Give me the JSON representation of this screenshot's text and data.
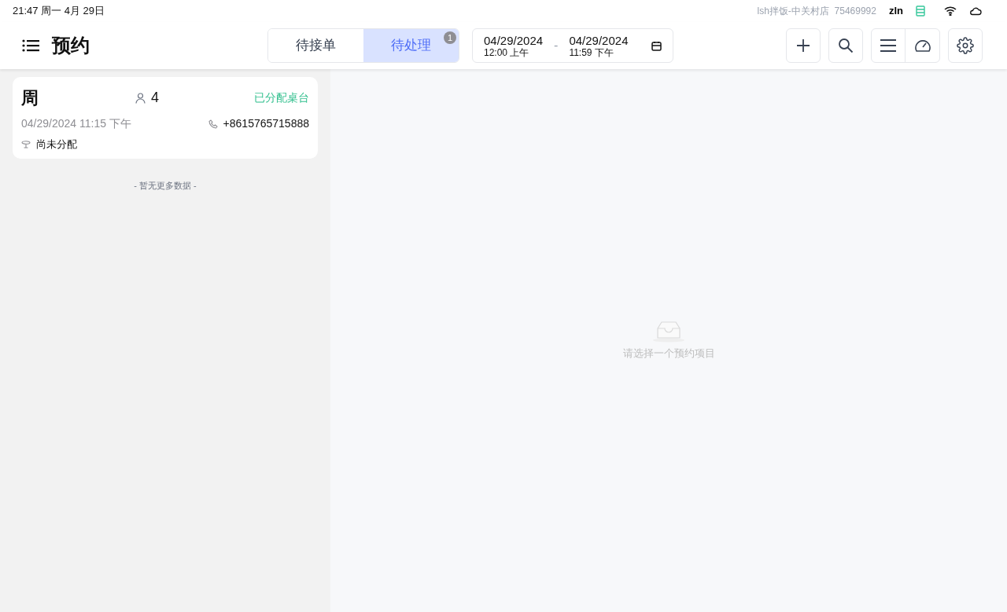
{
  "status_bar": {
    "time": "21:47 周一 4月 29日",
    "store": "lsh拌饭-中关村店  75469992",
    "user": "zln"
  },
  "header": {
    "title": "预约",
    "tabs": [
      {
        "label": "待接单",
        "selected": false
      },
      {
        "label": "待处理",
        "selected": true,
        "badge": "1"
      }
    ],
    "date_range": {
      "start_date": "04/29/2024",
      "start_time": "12:00 上午",
      "separator": "-",
      "end_date": "04/29/2024",
      "end_time": "11:59 下午"
    }
  },
  "reservations": [
    {
      "name": "周",
      "party_size": "4",
      "status": "已分配桌台",
      "datetime": "04/29/2024 11:15 下午",
      "phone": "+8615765715888",
      "table": "尚未分配"
    }
  ],
  "list_footer": "- 暂无更多数据 -",
  "empty_state": {
    "message": "请选择一个预约项目"
  }
}
